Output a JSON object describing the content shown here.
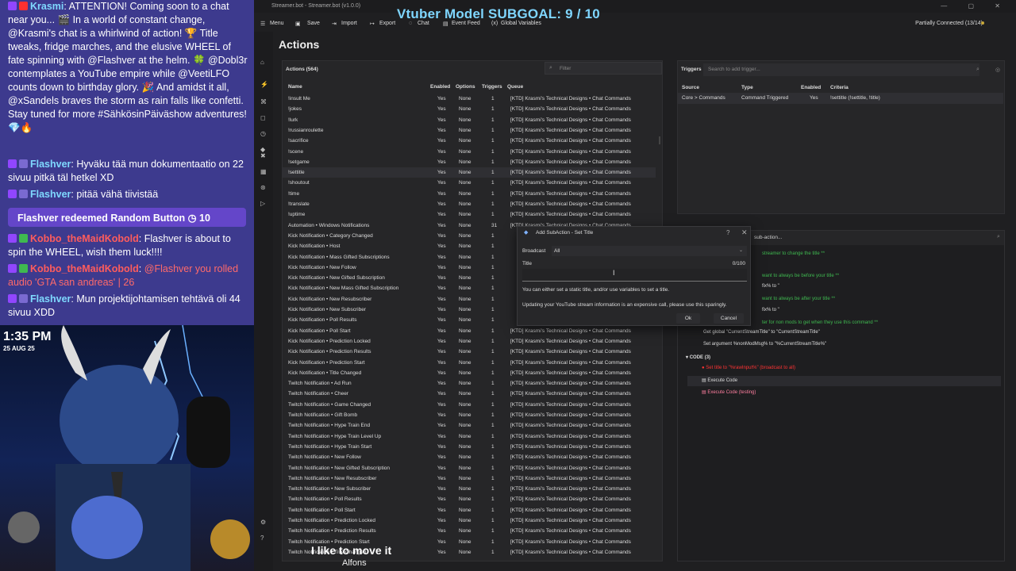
{
  "chat": {
    "messages": [
      {
        "name": "Krasmi",
        "text": ": ATTENTION! Coming soon to a chat near you... 🎬 In a world of constant change, @Krasmi's chat is a whirlwind of action! 🏆 Title tweaks, fridge marches, and the elusive WHEEL of fate spinning with @Flashver at the helm. 🍀 @Dobl3r contemplates a YouTube empire while @VeetiLFO counts down to birthday glory. 🎉 And amidst it all, @xSandels braves the storm as rain falls like confetti. Stay tuned for more #SähkösinPäiväshow adventures! 💎🔥"
      },
      {
        "name": "Flashver",
        "text": ": Hyväku tää mun dokumentaatio on 22 sivuu pitkä täl hetkel XD"
      },
      {
        "name": "Flashver",
        "text": ": pitää vähä tiivistää"
      },
      {
        "name": "Kobbo_theMaidKobold",
        "text": ": Flashver is about to spin the WHEEL, wish them luck!!!!"
      },
      {
        "name": "Kobbo_theMaidKobold",
        "text": ":",
        "red": "@Flashver you rolled audio 'GTA san andreas' | 26"
      },
      {
        "name": "Flashver",
        "text": ": Mun projektijohtamisen tehtävä oli 44 sivuu XDD"
      }
    ],
    "redeem": "Flashver redeemed Random Button ◷ 10"
  },
  "overlay": {
    "clock": "1:35 PM",
    "date": "25 AUG 25",
    "subgoal": "Vtuber Model SUBGOAL: 9 / 10",
    "caption_line1": "I like to move it",
    "caption_line2": "Alfons"
  },
  "app": {
    "window_title": "Streamer.bot - Streamer.bot (v1.0.0)",
    "window_buttons": "— ▢ ✕",
    "toolbar": {
      "menu": "Menu",
      "save": "Save",
      "import": "Import",
      "export": "Export",
      "chat": "Chat",
      "event_feed": "Event Feed",
      "global_variables": "Global Variables"
    },
    "connection_status": "Partially Connected (13/14)",
    "page_title": "Actions",
    "actions": {
      "header": "Actions (564)",
      "filter_placeholder": "Filter",
      "columns": {
        "name": "Name",
        "enabled": "Enabled",
        "options": "Options",
        "triggers": "Triggers",
        "queue": "Queue"
      },
      "rows": [
        [
          "!insult Me",
          "Yes",
          "None",
          "1",
          "[KTD] Krasmi's Technical Designs • Chat Commands"
        ],
        [
          "!jokes",
          "Yes",
          "None",
          "1",
          "[KTD] Krasmi's Technical Designs • Chat Commands"
        ],
        [
          "!lurk",
          "Yes",
          "None",
          "1",
          "[KTD] Krasmi's Technical Designs • Chat Commands"
        ],
        [
          "!russianroulette",
          "Yes",
          "None",
          "1",
          "[KTD] Krasmi's Technical Designs • Chat Commands"
        ],
        [
          "!sacrifice",
          "Yes",
          "None",
          "1",
          "[KTD] Krasmi's Technical Designs • Chat Commands"
        ],
        [
          "!scene",
          "Yes",
          "None",
          "1",
          "[KTD] Krasmi's Technical Designs • Chat Commands"
        ],
        [
          "!setgame",
          "Yes",
          "None",
          "1",
          "[KTD] Krasmi's Technical Designs • Chat Commands"
        ],
        [
          "!settitle",
          "Yes",
          "None",
          "1",
          "[KTD] Krasmi's Technical Designs • Chat Commands"
        ],
        [
          "!shoutout",
          "Yes",
          "None",
          "1",
          "[KTD] Krasmi's Technical Designs • Chat Commands"
        ],
        [
          "!time",
          "Yes",
          "None",
          "1",
          "[KTD] Krasmi's Technical Designs • Chat Commands"
        ],
        [
          "!translate",
          "Yes",
          "None",
          "1",
          "[KTD] Krasmi's Technical Designs • Chat Commands"
        ],
        [
          "!uptime",
          "Yes",
          "None",
          "1",
          "[KTD] Krasmi's Technical Designs • Chat Commands"
        ],
        [
          "Automation • Windows Notifications",
          "Yes",
          "None",
          "31",
          "[KTD] Krasmi's Technical Designs • Chat Commands"
        ],
        [
          "Kick Notification • Category Changed",
          "Yes",
          "None",
          "1",
          ""
        ],
        [
          "Kick Notification • Host",
          "Yes",
          "None",
          "1",
          ""
        ],
        [
          "Kick Notification • Mass Gifted Subscriptions",
          "Yes",
          "None",
          "1",
          ""
        ],
        [
          "Kick Notification • New Follow",
          "Yes",
          "None",
          "1",
          ""
        ],
        [
          "Kick Notification • New Gifted Subscription",
          "Yes",
          "None",
          "1",
          ""
        ],
        [
          "Kick Notification • New Mass Gifted Subscription",
          "Yes",
          "None",
          "1",
          ""
        ],
        [
          "Kick Notification • New Resubscriber",
          "Yes",
          "None",
          "1",
          ""
        ],
        [
          "Kick Notification • New Subscriber",
          "Yes",
          "None",
          "1",
          ""
        ],
        [
          "Kick Notification • Poll Results",
          "Yes",
          "None",
          "1",
          ""
        ],
        [
          "Kick Notification • Poll Start",
          "Yes",
          "None",
          "1",
          "[KTD] Krasmi's Technical Designs • Chat Commands"
        ],
        [
          "Kick Notification • Prediction Locked",
          "Yes",
          "None",
          "1",
          "[KTD] Krasmi's Technical Designs • Chat Commands"
        ],
        [
          "Kick Notification • Prediction Results",
          "Yes",
          "None",
          "1",
          "[KTD] Krasmi's Technical Designs • Chat Commands"
        ],
        [
          "Kick Notification • Prediction Start",
          "Yes",
          "None",
          "1",
          "[KTD] Krasmi's Technical Designs • Chat Commands"
        ],
        [
          "Kick Notification • Title Changed",
          "Yes",
          "None",
          "1",
          "[KTD] Krasmi's Technical Designs • Chat Commands"
        ],
        [
          "Twitch Notification • Ad Run",
          "Yes",
          "None",
          "1",
          "[KTD] Krasmi's Technical Designs • Chat Commands"
        ],
        [
          "Twitch Notification • Cheer",
          "Yes",
          "None",
          "1",
          "[KTD] Krasmi's Technical Designs • Chat Commands"
        ],
        [
          "Twitch Notification • Game Changed",
          "Yes",
          "None",
          "1",
          "[KTD] Krasmi's Technical Designs • Chat Commands"
        ],
        [
          "Twitch Notification • Gift Bomb",
          "Yes",
          "None",
          "1",
          "[KTD] Krasmi's Technical Designs • Chat Commands"
        ],
        [
          "Twitch Notification • Hype Train End",
          "Yes",
          "None",
          "1",
          "[KTD] Krasmi's Technical Designs • Chat Commands"
        ],
        [
          "Twitch Notification • Hype Train Level Up",
          "Yes",
          "None",
          "1",
          "[KTD] Krasmi's Technical Designs • Chat Commands"
        ],
        [
          "Twitch Notification • Hype Train Start",
          "Yes",
          "None",
          "1",
          "[KTD] Krasmi's Technical Designs • Chat Commands"
        ],
        [
          "Twitch Notification • New Follow",
          "Yes",
          "None",
          "1",
          "[KTD] Krasmi's Technical Designs • Chat Commands"
        ],
        [
          "Twitch Notification • New Gifted Subscription",
          "Yes",
          "None",
          "1",
          "[KTD] Krasmi's Technical Designs • Chat Commands"
        ],
        [
          "Twitch Notification • New Resubscriber",
          "Yes",
          "None",
          "1",
          "[KTD] Krasmi's Technical Designs • Chat Commands"
        ],
        [
          "Twitch Notification • New Subscriber",
          "Yes",
          "None",
          "1",
          "[KTD] Krasmi's Technical Designs • Chat Commands"
        ],
        [
          "Twitch Notification • Poll Results",
          "Yes",
          "None",
          "1",
          "[KTD] Krasmi's Technical Designs • Chat Commands"
        ],
        [
          "Twitch Notification • Poll Start",
          "Yes",
          "None",
          "1",
          "[KTD] Krasmi's Technical Designs • Chat Commands"
        ],
        [
          "Twitch Notification • Prediction Locked",
          "Yes",
          "None",
          "1",
          "[KTD] Krasmi's Technical Designs • Chat Commands"
        ],
        [
          "Twitch Notification • Prediction Results",
          "Yes",
          "None",
          "1",
          "[KTD] Krasmi's Technical Designs • Chat Commands"
        ],
        [
          "Twitch Notification • Prediction Start",
          "Yes",
          "None",
          "1",
          "[KTD] Krasmi's Technical Designs • Chat Commands"
        ],
        [
          "Twitch Notification • Title Changed",
          "Yes",
          "None",
          "1",
          "[KTD] Krasmi's Technical Designs • Chat Commands"
        ]
      ],
      "selected_row": 7
    },
    "triggers": {
      "header": "Triggers",
      "search_placeholder": "Search to add trigger...",
      "columns": {
        "source": "Source",
        "type": "Type",
        "enabled": "Enabled",
        "criteria": "Criteria"
      },
      "row": {
        "source": "Core > Commands",
        "type": "Command Triggered",
        "enabled": "Yes",
        "criteria": "!settitle (!settitle, !title)"
      }
    },
    "subactions": {
      "header": "sub-action...",
      "lines": [
        {
          "text": "streamer to change the title **",
          "style": "g"
        },
        {
          "text": "want to always be before your title **",
          "style": "g"
        },
        {
          "text": "fix% to \"",
          "style": "w"
        },
        {
          "text": "want to always be after your title **",
          "style": "g"
        },
        {
          "text": "fix% to \"",
          "style": "w"
        },
        {
          "text": "ter for non mods to get when they use this command **",
          "style": "g"
        },
        {
          "text": "Get global \"CurrentStreamTitle\" to \"CurrentStreamTitle\"",
          "style": "w"
        },
        {
          "text": "Set argument %nonModMsg% to \"%CurrentStreamTitle%\"",
          "style": "w"
        },
        {
          "text": "CODE (3)",
          "style": "w"
        },
        {
          "text": "Set title to \"%rawInput%\" (broadcast to all)",
          "style": "rb"
        },
        {
          "text": "Execute Code",
          "style": "w"
        },
        {
          "text": "Execute Code (testing)",
          "style": "pink"
        }
      ]
    },
    "dialog": {
      "title": "Add SubAction - Set Title",
      "help": "?",
      "close": "✕",
      "broadcast_label": "Broadcast",
      "broadcast_value": "All",
      "title_label": "Title",
      "title_count": "0/100",
      "title_value": "",
      "info1": "You can either set a static title, and/or use variables to set a title.",
      "info2": "Updating your YouTube stream information is an expensive call, please use this sparingly.",
      "ok": "Ok",
      "cancel": "Cancel"
    }
  },
  "colors": {
    "chat_bg": "#3d3a8e",
    "subgoal": "#7fd6ff",
    "app_bg": "#1f1f21",
    "accent_green": "#3fb950",
    "accent_red": "#ff5c5c"
  }
}
